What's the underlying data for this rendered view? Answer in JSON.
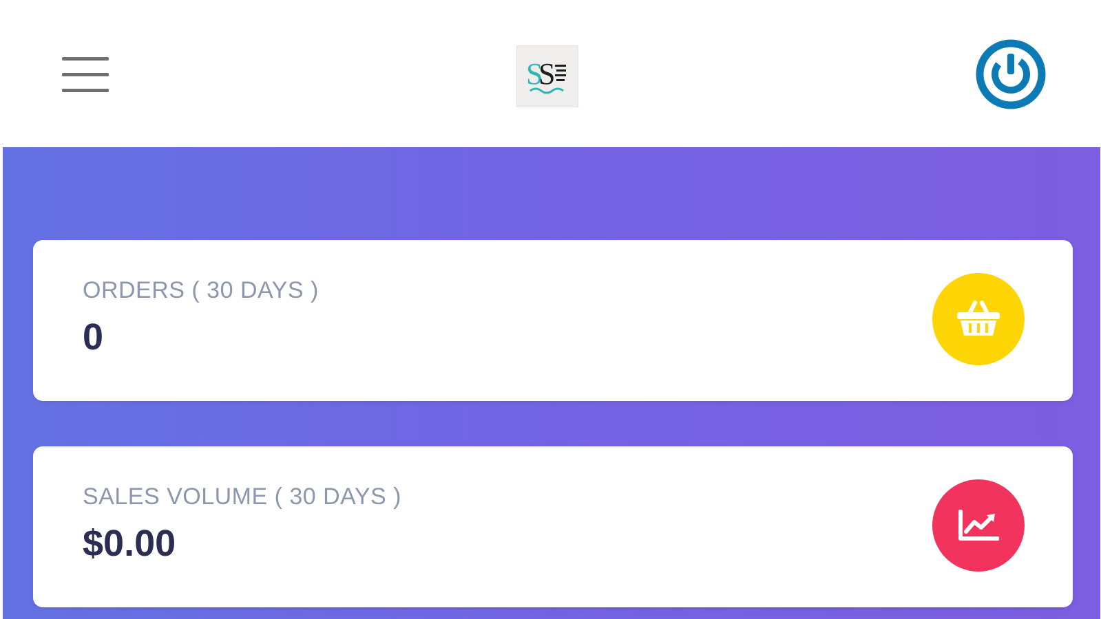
{
  "colors": {
    "header_background": "#ffffff",
    "hero_gradient_start": "#6472e3",
    "hero_gradient_end": "#7c5ee0",
    "card_background": "#ffffff",
    "label_color": "#8c97ad",
    "value_color": "#2c2d52",
    "power_icon_color": "#0b7ab5",
    "orders_icon_background": "#fdd404",
    "sales_icon_background": "#f2335d",
    "logo_teal": "#2bb6b8"
  },
  "header": {
    "menu_icon": "hamburger-menu-icon",
    "logo_icon": "brand-logo",
    "power_icon": "power-icon"
  },
  "stats": {
    "orders": {
      "label": "ORDERS ( 30 DAYS )",
      "value": "0",
      "icon": "shopping-basket-icon"
    },
    "sales": {
      "label": "SALES VOLUME ( 30 DAYS )",
      "value": "$0.00",
      "icon": "line-chart-icon"
    }
  }
}
